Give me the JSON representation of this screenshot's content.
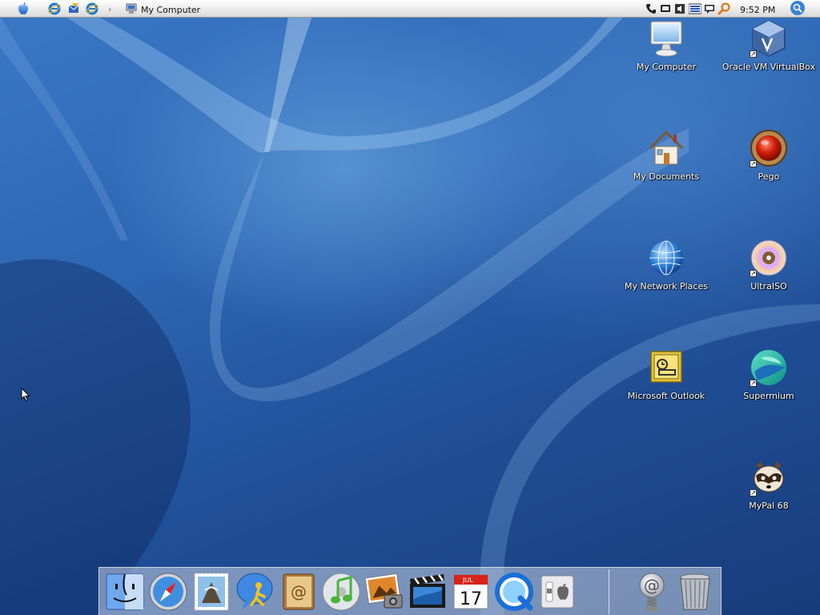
{
  "menubar": {
    "active_window_title": "My Computer",
    "clock": "9:52 PM",
    "chevron": "›"
  },
  "desktop_icons": [
    {
      "label": "My Computer",
      "icon": "monitor-icon",
      "shortcut": false
    },
    {
      "label": "Oracle VM VirtualBox",
      "icon": "virtualbox-cube-icon",
      "shortcut": true
    },
    {
      "label": "My Documents",
      "icon": "house-icon",
      "shortcut": false
    },
    {
      "label": "Pego",
      "icon": "red-ball-icon",
      "shortcut": true
    },
    {
      "label": "My Network Places",
      "icon": "globe-icon",
      "shortcut": false
    },
    {
      "label": "UltraISO",
      "icon": "disc-icon",
      "shortcut": true
    },
    {
      "label": "Microsoft Outlook",
      "icon": "outlook-icon",
      "shortcut": false
    },
    {
      "label": "Supermium",
      "icon": "supermium-icon",
      "shortcut": true
    },
    {
      "label": "MyPal 68",
      "icon": "raccoon-icon",
      "shortcut": true
    }
  ],
  "dock_items": [
    {
      "icon": "finder-icon"
    },
    {
      "icon": "safari-compass-icon"
    },
    {
      "icon": "mail-stamp-icon"
    },
    {
      "icon": "ichat-icon"
    },
    {
      "icon": "address-book-icon"
    },
    {
      "icon": "itunes-icon"
    },
    {
      "icon": "iphoto-icon"
    },
    {
      "icon": "imovie-icon"
    },
    {
      "icon": "ical-icon"
    },
    {
      "icon": "quicktime-icon"
    },
    {
      "icon": "system-preferences-icon"
    },
    {
      "icon": "mail-at-spring-icon"
    },
    {
      "icon": "trash-icon"
    }
  ],
  "ical_date": {
    "month": "JUL",
    "day": "17"
  },
  "colors": {
    "menubar_bg": "#ececec",
    "desktop_blue": "#2d66b3",
    "search_button": "#3b82d6"
  }
}
